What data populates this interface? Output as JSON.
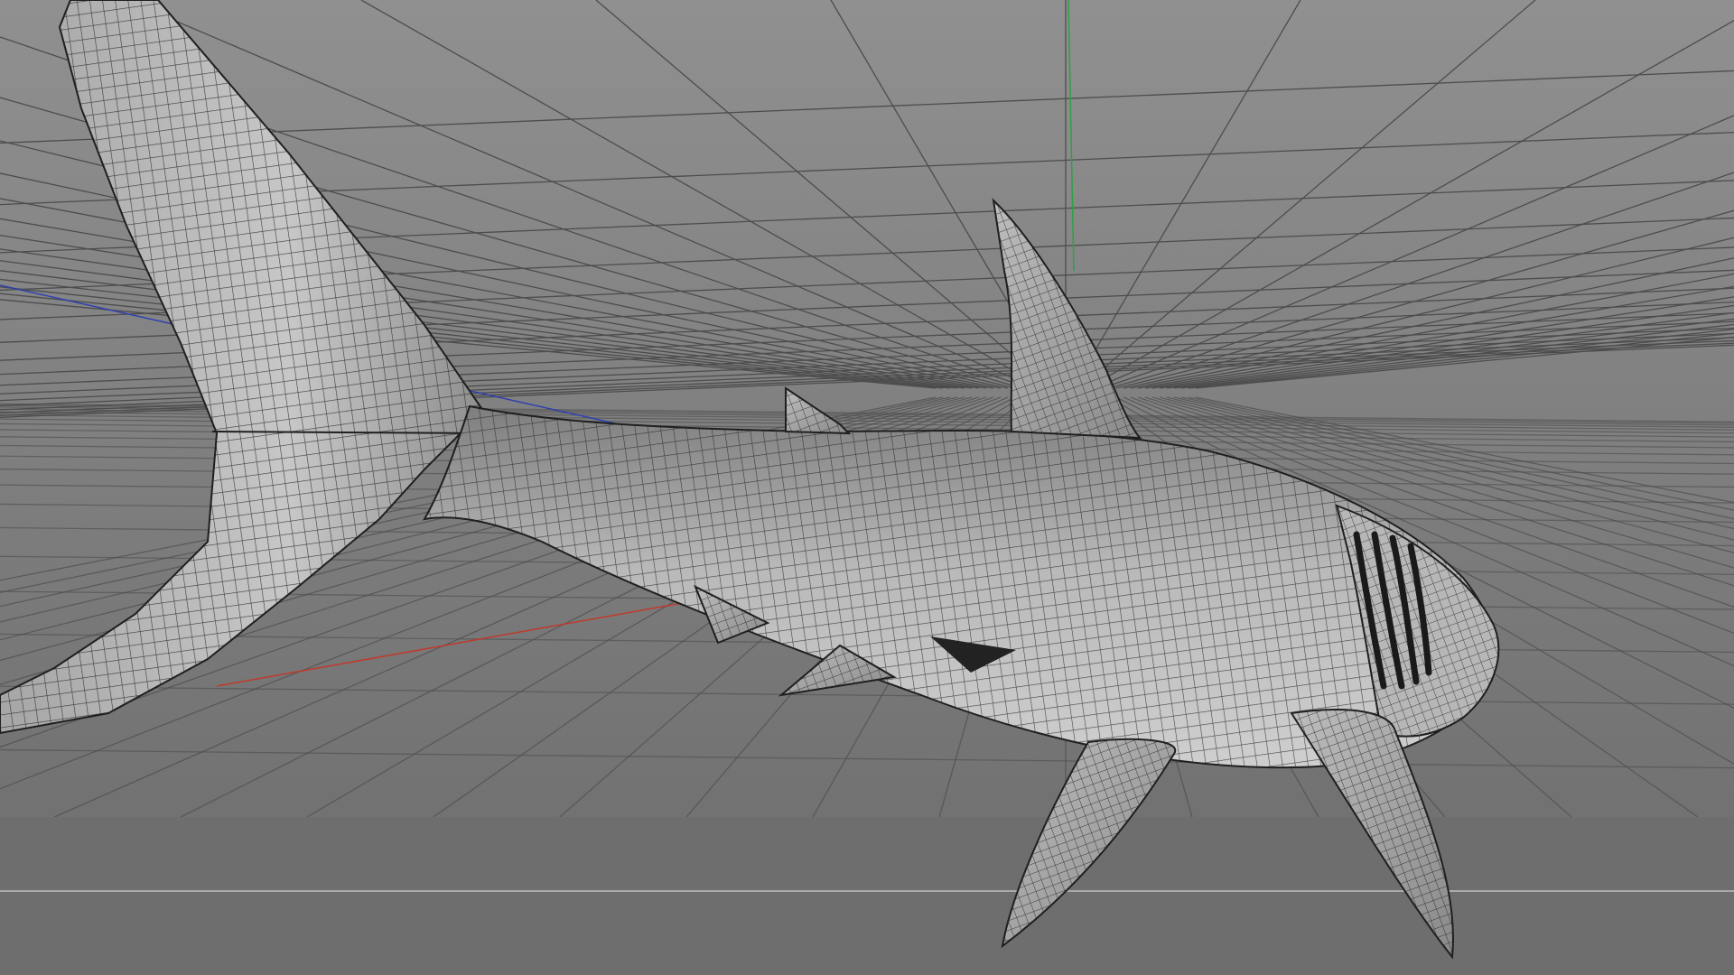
{
  "viewport": {
    "title": "",
    "background_top": "#8f8f8f",
    "background_bottom": "#6e6e6e",
    "grid_color": "#4a4a4a",
    "axis_x_color": "#c0392b",
    "axis_y_color": "#2ea043",
    "axis_z_color": "#2f3fb0",
    "horizon_color": "#b8b8b8",
    "model": {
      "name": "",
      "display_mode": "wireframe-over-shaded",
      "mesh_color": "#2a2a2a",
      "surface_color": "#a8a8a8"
    },
    "parts": [
      "caudal-fin",
      "body",
      "dorsal-fin",
      "second-dorsal-fin",
      "anal-fin",
      "pelvic-fin",
      "pectoral-fin-left",
      "pectoral-fin-right",
      "head",
      "gill-slits",
      "mouth"
    ]
  }
}
